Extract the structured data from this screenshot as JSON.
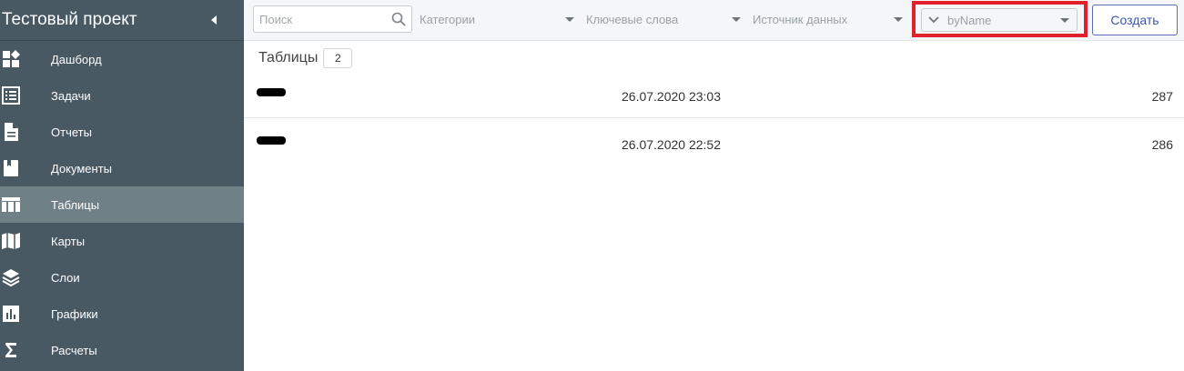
{
  "sidebar": {
    "title": "Тестовый проект",
    "items": [
      {
        "label": "Дашборд",
        "icon": "dashboard-icon"
      },
      {
        "label": "Задачи",
        "icon": "tasks-list-icon"
      },
      {
        "label": "Отчеты",
        "icon": "report-document-icon"
      },
      {
        "label": "Документы",
        "icon": "book-icon"
      },
      {
        "label": "Таблицы",
        "icon": "table-icon",
        "active": true
      },
      {
        "label": "Карты",
        "icon": "map-icon"
      },
      {
        "label": "Слои",
        "icon": "layers-icon"
      },
      {
        "label": "Графики",
        "icon": "bar-chart-icon"
      },
      {
        "label": "Расчеты",
        "icon": "sigma-icon"
      }
    ]
  },
  "toolbar": {
    "search_placeholder": "Поиск",
    "categories": "Категории",
    "keywords": "Ключевые слова",
    "data_source": "Источник данных",
    "sort": "byName",
    "create_label": "Создать"
  },
  "main": {
    "section_title": "Таблицы",
    "count": "2",
    "rows": [
      {
        "date": "26.07.2020 23:03",
        "id": "287"
      },
      {
        "date": "26.07.2020 22:52",
        "id": "286"
      }
    ]
  },
  "colors": {
    "sidebar_bg": "#485963",
    "sidebar_active": "#6f8087",
    "highlight_border": "#e0202a",
    "button_text": "#3f56a6"
  }
}
